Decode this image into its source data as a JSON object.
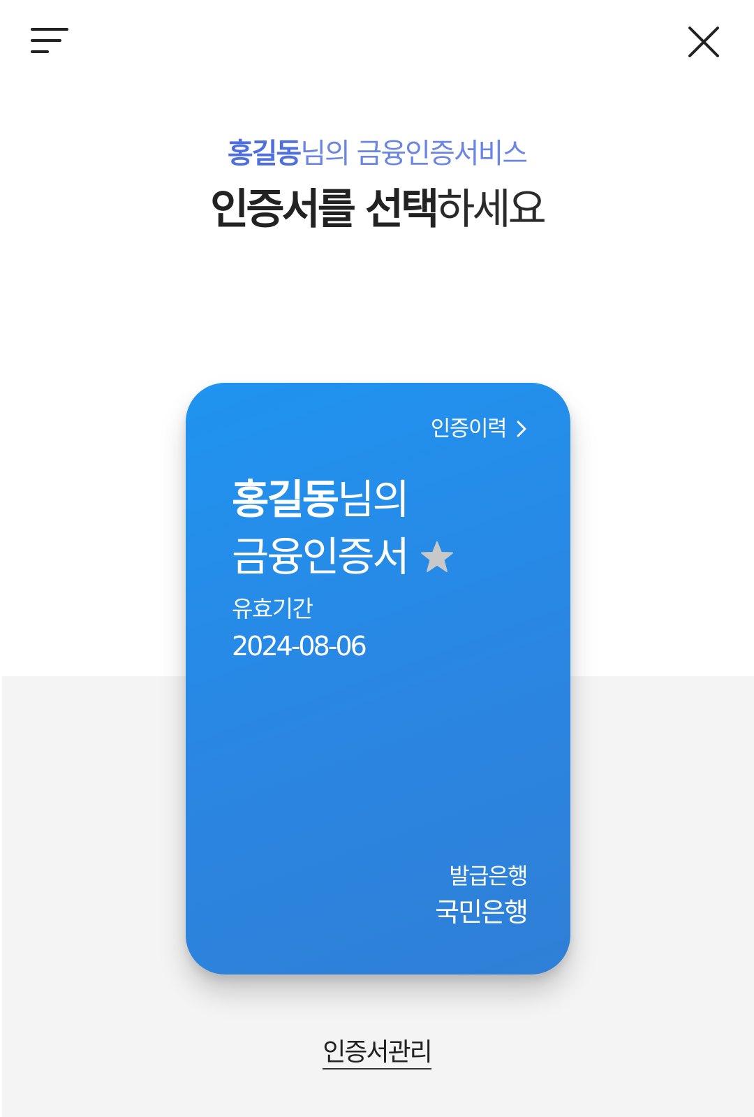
{
  "header": {
    "menu_icon": "hamburger-menu-icon",
    "close_icon": "close-icon"
  },
  "intro": {
    "user_name": "홍길동",
    "subtitle_rest": "님의 금융인증서비스",
    "headline_bold": "인증서를 선택",
    "headline_rest": "하세요"
  },
  "card": {
    "history_label": "인증이력",
    "name": "홍길동",
    "title_suffix": "님의",
    "title_line2": "금융인증서",
    "favorite_icon": "star-icon",
    "valid_label": "유효기간",
    "valid_date": "2024-08-06",
    "issuer_label": "발급은행",
    "issuer_value": "국민은행",
    "colors": {
      "gradient_start": "#1f94f0",
      "gradient_end": "#2f7fd6",
      "star": "#c8c8c8"
    }
  },
  "footer": {
    "manage_label": "인증서관리"
  },
  "colors": {
    "accent_subtitle": "#4f70dc",
    "bottom_background": "#f4f4f4"
  }
}
